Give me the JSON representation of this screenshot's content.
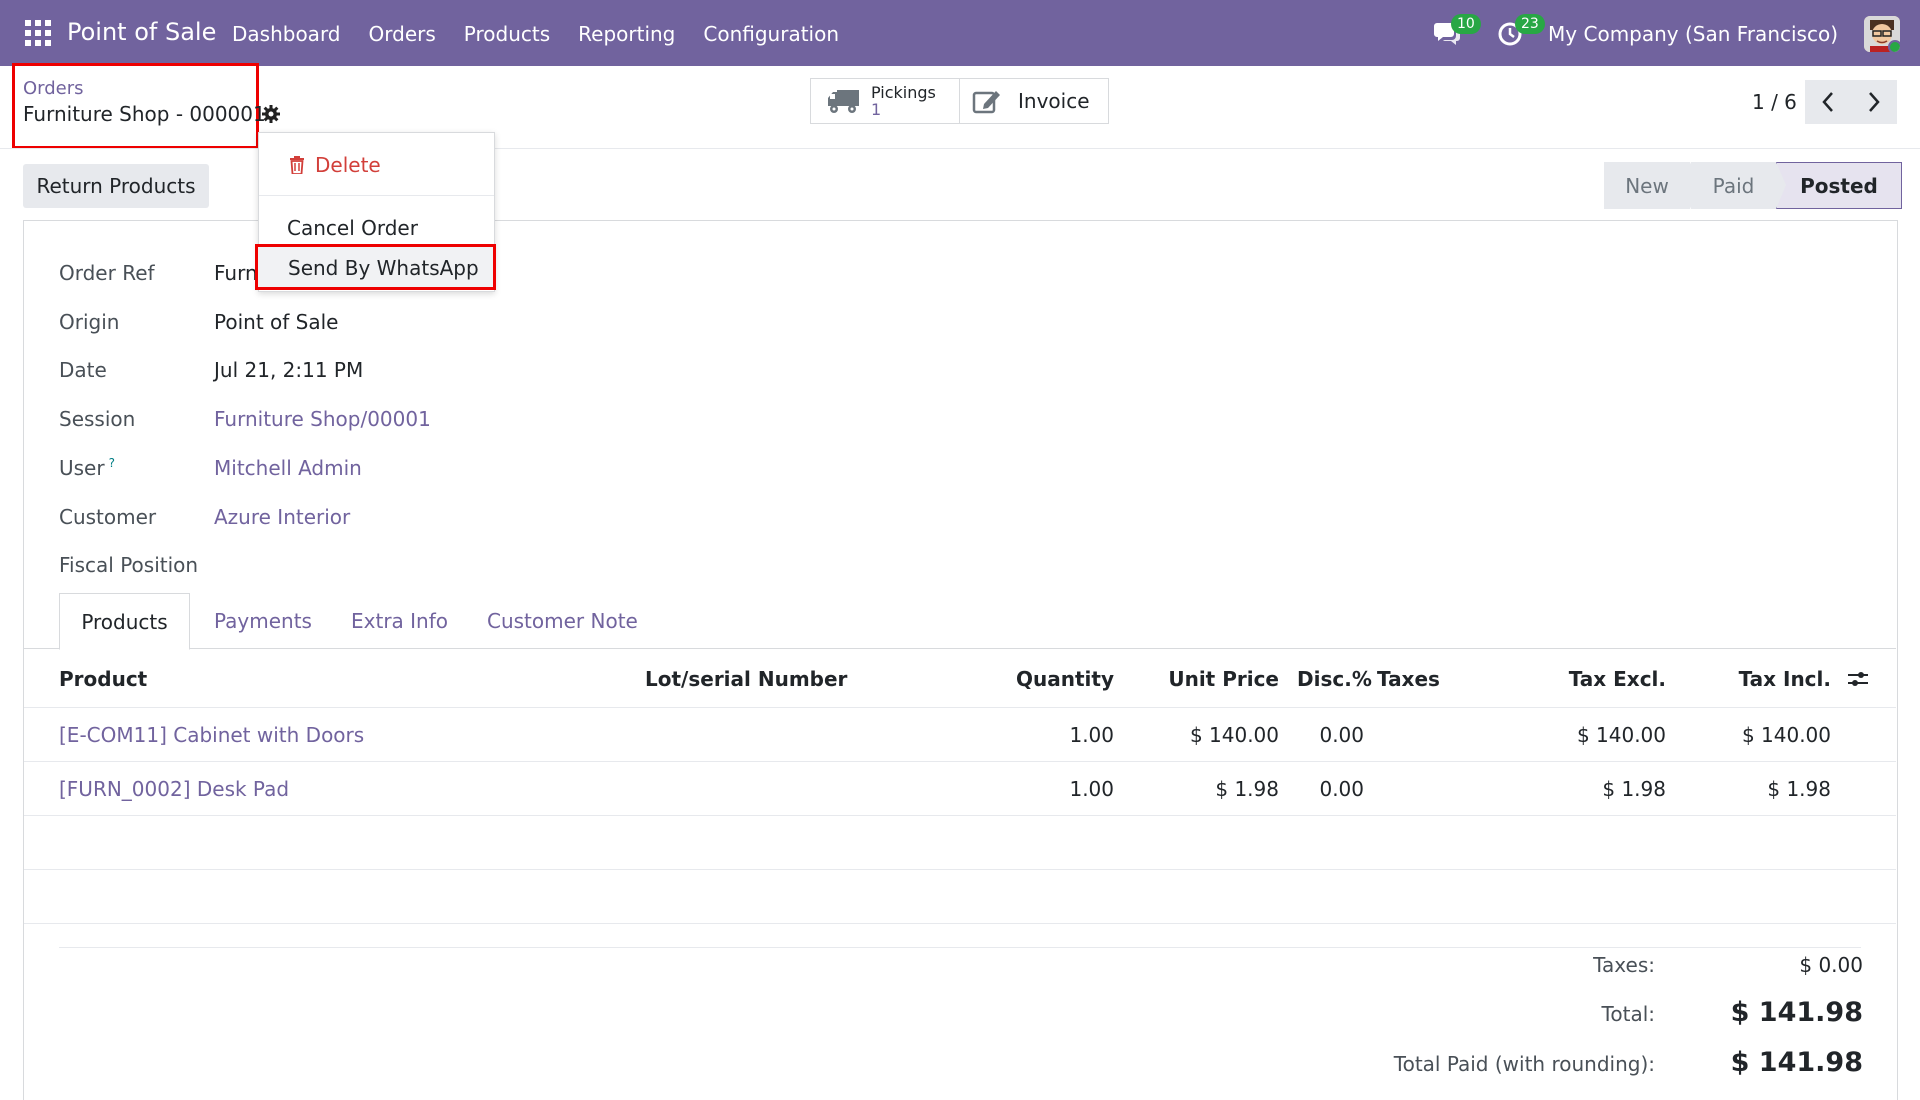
{
  "navbar": {
    "app_name": "Point of Sale",
    "menu": [
      "Dashboard",
      "Orders",
      "Products",
      "Reporting",
      "Configuration"
    ],
    "messages_count": "10",
    "activities_count": "23",
    "company": "My Company (San Francisco)"
  },
  "breadcrumb": {
    "parent": "Orders",
    "current": "Furniture Shop - 000001"
  },
  "smart_buttons": {
    "pickings_label": "Pickings",
    "pickings_count": "1",
    "invoice_label": "Invoice"
  },
  "pager": {
    "value": "1 / 6"
  },
  "actions_menu": {
    "delete": "Delete",
    "cancel": "Cancel Order",
    "whatsapp": "Send By WhatsApp"
  },
  "return_button": "Return Products",
  "status": {
    "stages": [
      "New",
      "Paid",
      "Posted"
    ],
    "current": "Posted"
  },
  "fields": {
    "order_ref_label": "Order Ref",
    "order_ref_value": "Furn",
    "origin_label": "Origin",
    "origin_value": "Point of Sale",
    "date_label": "Date",
    "date_value": "Jul 21, 2:11 PM",
    "session_label": "Session",
    "session_value": "Furniture Shop/00001",
    "user_label": "User",
    "user_help": "?",
    "user_value": "Mitchell Admin",
    "customer_label": "Customer",
    "customer_value": "Azure Interior",
    "fiscal_label": "Fiscal Position"
  },
  "tabs": [
    "Products",
    "Payments",
    "Extra Info",
    "Customer Note"
  ],
  "table": {
    "headers": {
      "product": "Product",
      "lot": "Lot/serial Number",
      "qty": "Quantity",
      "price": "Unit Price",
      "disc": "Disc.%",
      "taxes": "Taxes",
      "excl": "Tax Excl.",
      "incl": "Tax Incl."
    },
    "rows": [
      {
        "product": "[E-COM11] Cabinet with Doors",
        "qty": "1.00",
        "price": "$ 140.00",
        "disc": "0.00",
        "excl": "$ 140.00",
        "incl": "$ 140.00"
      },
      {
        "product": "[FURN_0002] Desk Pad",
        "qty": "1.00",
        "price": "$ 1.98",
        "disc": "0.00",
        "excl": "$ 1.98",
        "incl": "$ 1.98"
      }
    ]
  },
  "totals": {
    "taxes_label": "Taxes:",
    "taxes_value": "$ 0.00",
    "total_label": "Total:",
    "total_value": "$ 141.98",
    "paid_label": "Total Paid (with rounding):",
    "paid_value": "$ 141.98"
  },
  "colors": {
    "brand": "#71639e",
    "danger": "#d23f3a",
    "badge": "#28a745",
    "highlight_box": "#ee0000"
  }
}
